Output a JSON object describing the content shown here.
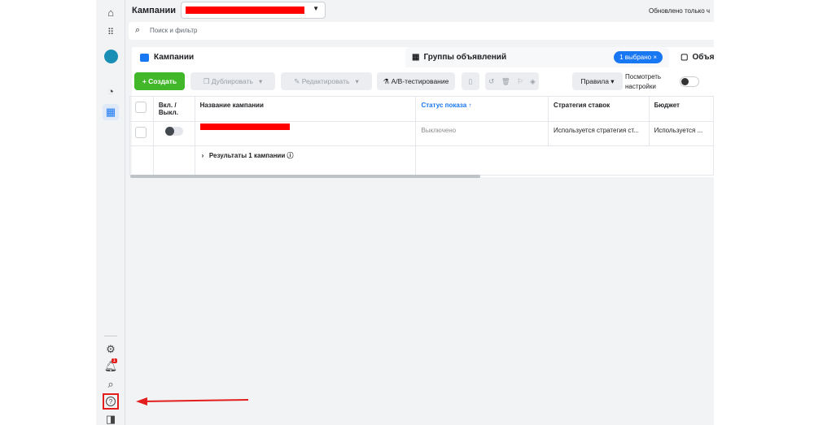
{
  "header": {
    "title": "Кампании",
    "updated": "Обновлено только ч"
  },
  "search": {
    "placeholder": "Поиск и фильтр"
  },
  "tabs": [
    {
      "label": "Кампании"
    },
    {
      "label": "Группы объявлений",
      "badge": "1 выбрано"
    },
    {
      "label": "Объя"
    }
  ],
  "toolbar": {
    "create": "Создать",
    "duplicate": "Дублировать",
    "edit": "Редактировать",
    "ab": "A/B-тестирование",
    "rules": "Правила",
    "view_settings": "Посмотреть настройки"
  },
  "table": {
    "headers": [
      "Вкл. / Выкл.",
      "Название кампании",
      "Статус показа",
      "Стратегия ставок",
      "Бюджет"
    ],
    "rows": [
      {
        "status": "Выключено",
        "strategy": "Используется стратегия ст...",
        "budget": "Используется ..."
      }
    ],
    "summary": "Результаты 1 кампании"
  },
  "sidebar": {
    "notification_count": "1"
  },
  "colors": {
    "accent": "#1877f2",
    "create": "#42b72a",
    "highlight": "#e41e1e"
  }
}
